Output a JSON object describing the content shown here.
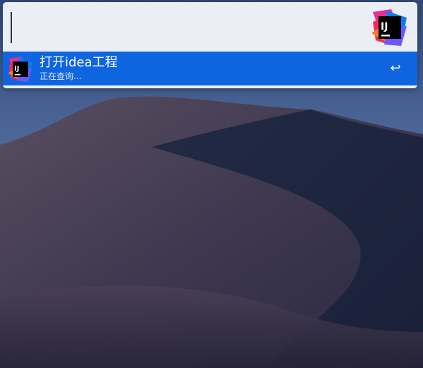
{
  "search": {
    "value": "",
    "placeholder": ""
  },
  "results": [
    {
      "title": "打开idea工程",
      "subtitle": "正在查询...",
      "icon": "intellij-idea-icon",
      "action_icon": "return-key-icon",
      "action_glyph": "↩"
    }
  ],
  "colors": {
    "panel": "#ebeef5",
    "selected_row": "#0f65df"
  }
}
